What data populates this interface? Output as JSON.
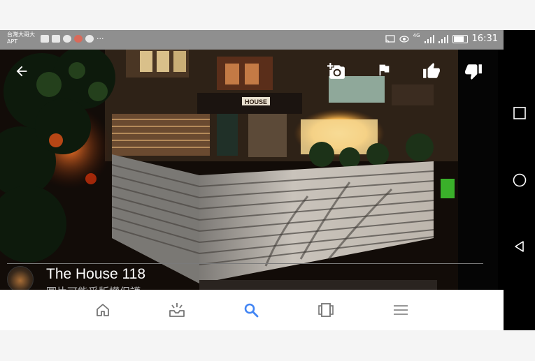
{
  "status_bar": {
    "carrier_line1": "台灣大哥大",
    "carrier_line2": "APT",
    "network_label": "4G",
    "time": "16:31",
    "battery_level": 0.8,
    "notification_icons": [
      "activity-icon",
      "mail-icon",
      "chat-icon",
      "app-icon",
      "chrome-icon",
      "more-dots-icon"
    ],
    "more": "···"
  },
  "toolbar": {
    "back_icon": "back-arrow-icon",
    "actions": [
      "add-photo-icon",
      "flag-icon",
      "thumbs-up-icon",
      "thumbs-down-icon"
    ]
  },
  "photo": {
    "sign_text": "HOUSE"
  },
  "caption": {
    "title": "The House 118",
    "subtitle": "圖片可能受版權保護。"
  },
  "bottom_nav": {
    "items": [
      "home-icon",
      "updates-icon",
      "search-icon",
      "collections-icon",
      "menu-icon"
    ],
    "active_color": "#4285f4",
    "inactive_color": "#757575"
  },
  "android_nav": {
    "buttons": [
      "recent-apps-icon",
      "home-circle-icon",
      "back-triangle-icon"
    ]
  }
}
